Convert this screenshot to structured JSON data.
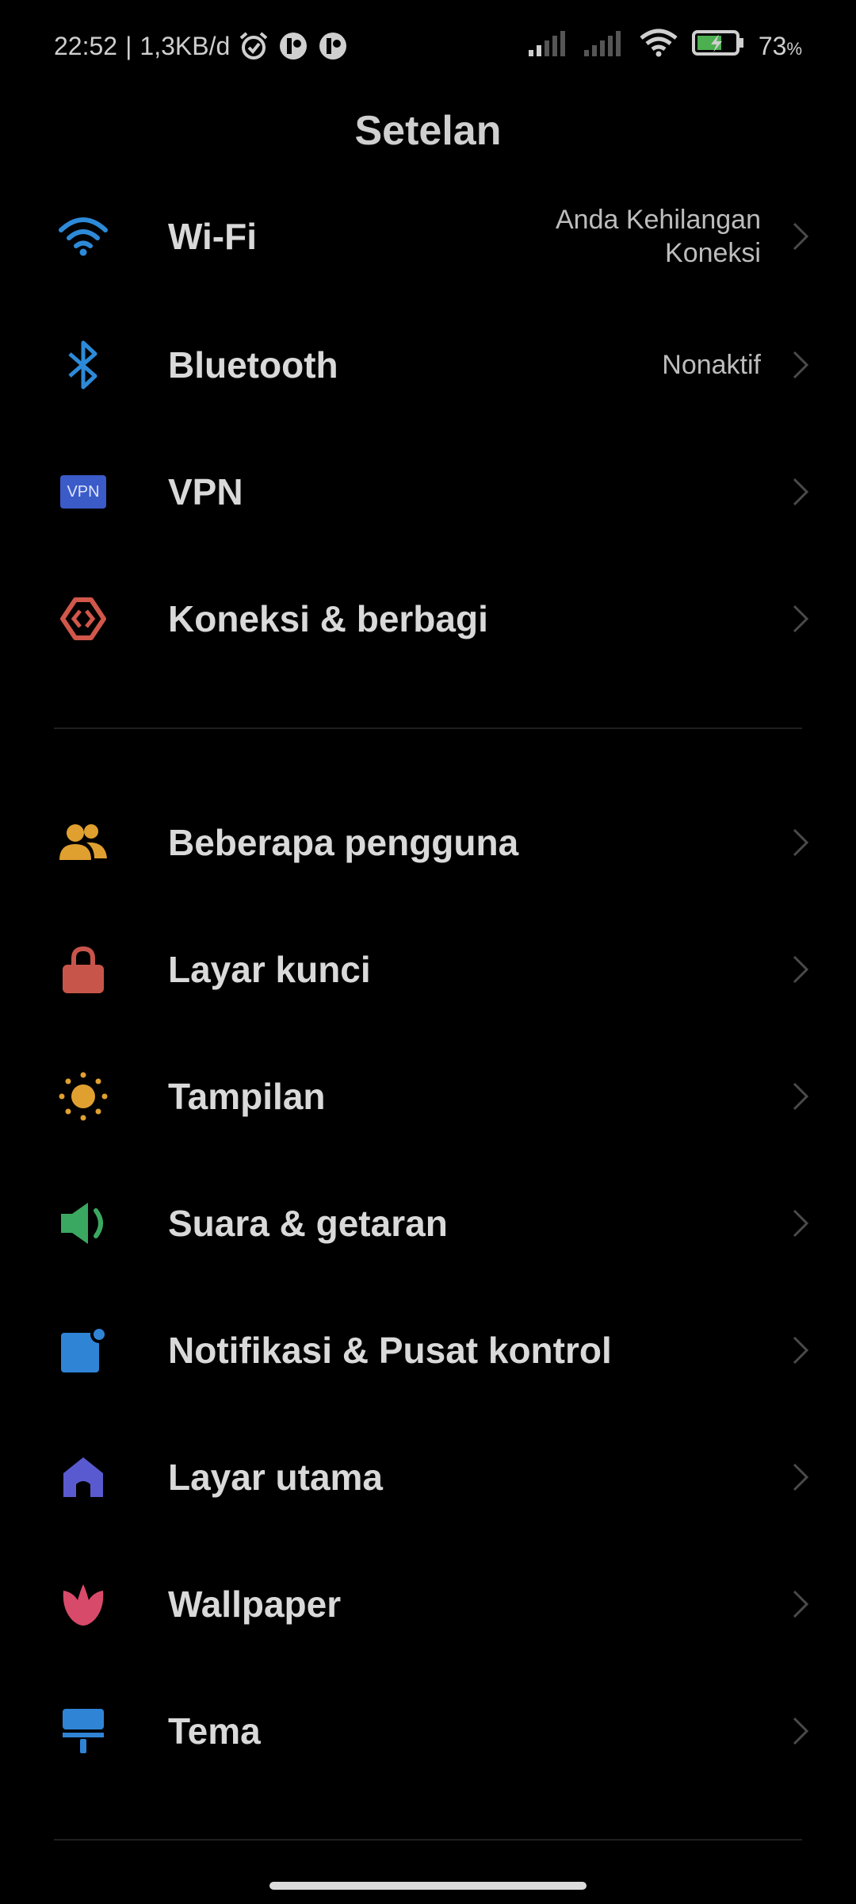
{
  "status_bar": {
    "time": "22:52",
    "separator": "|",
    "network_speed": "1,3KB/d",
    "battery_level": "73",
    "battery_unit": "%"
  },
  "header": {
    "title": "Setelan"
  },
  "colors": {
    "wifi": "#2d8ad8",
    "bluetooth": "#2d8ad8",
    "vpn": "#3b5bc8",
    "connection": "#d1574a",
    "users": "#e0a030",
    "lock": "#c8554a",
    "display": "#e0a030",
    "sound": "#3aa860",
    "notifications": "#2f84d6",
    "home": "#5a5ad0",
    "wallpaper": "#d84a6a",
    "theme": "#2f84d6"
  },
  "sections": [
    {
      "items": [
        {
          "label": "Wi-Fi",
          "value_line1": "Anda Kehilangan",
          "value_line2": "Koneksi",
          "icon": "wifi-icon"
        },
        {
          "label": "Bluetooth",
          "value": "Nonaktif",
          "icon": "bluetooth-icon"
        },
        {
          "label": "VPN",
          "icon": "vpn-icon",
          "icon_text": "VPN"
        },
        {
          "label": "Koneksi & berbagi",
          "icon": "connection-sharing-icon"
        }
      ]
    },
    {
      "items": [
        {
          "label": "Beberapa pengguna",
          "icon": "users-icon"
        },
        {
          "label": "Layar kunci",
          "icon": "lock-icon"
        },
        {
          "label": "Tampilan",
          "icon": "sun-icon"
        },
        {
          "label": "Suara & getaran",
          "icon": "speaker-icon"
        },
        {
          "label": "Notifikasi & Pusat kontrol",
          "icon": "notification-icon"
        },
        {
          "label": "Layar utama",
          "icon": "home-icon"
        },
        {
          "label": "Wallpaper",
          "icon": "flower-icon"
        },
        {
          "label": "Tema",
          "icon": "brush-icon"
        }
      ]
    }
  ]
}
